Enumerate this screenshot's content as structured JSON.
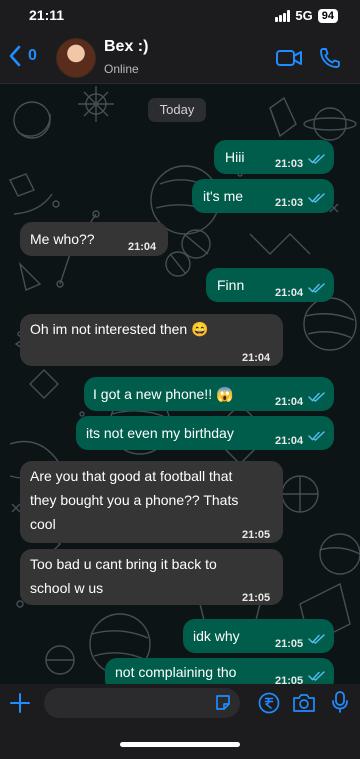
{
  "status_bar": {
    "time": "21:11",
    "network": "5G",
    "battery": "94"
  },
  "header": {
    "back_count": "0",
    "contact_name": "Bex :)",
    "contact_status": "Online"
  },
  "chat": {
    "date_label": "Today",
    "messages": [
      {
        "direction": "out",
        "text": "Hiii",
        "time": "21:03"
      },
      {
        "direction": "out",
        "text": "it's me",
        "time": "21:03"
      },
      {
        "direction": "in",
        "text": "Me who??",
        "time": "21:04"
      },
      {
        "direction": "out",
        "text": "Finn",
        "time": "21:04"
      },
      {
        "direction": "in",
        "text": "Oh im not interested then 😄",
        "time": "21:04"
      },
      {
        "direction": "out",
        "text": "I got a new phone!! 😱",
        "time": "21:04"
      },
      {
        "direction": "out",
        "text": "its not even my birthday",
        "time": "21:04"
      },
      {
        "direction": "in",
        "text_lines": [
          "Are you that good at football that",
          "they bought you a phone?? Thats",
          "cool"
        ],
        "time": "21:05"
      },
      {
        "direction": "in",
        "text_lines": [
          "Too bad u cant bring it back to",
          "school w us"
        ],
        "time": "21:05"
      },
      {
        "direction": "out",
        "text": "idk why",
        "time": "21:05"
      },
      {
        "direction": "out",
        "text": "not complaining tho",
        "time": "21:05"
      }
    ]
  },
  "colors": {
    "accent": "#1f8cff",
    "outgoing_bubble": "#005c4b",
    "incoming_bubble": "#353535",
    "read_ticks": "#53bdeb"
  },
  "icons": {
    "back": "chevron-left-icon",
    "video": "video-call-icon",
    "call": "phone-icon",
    "attach": "plus-icon",
    "sticker": "sticker-icon",
    "payment": "rupee-icon",
    "camera": "camera-icon",
    "mic": "microphone-icon"
  }
}
